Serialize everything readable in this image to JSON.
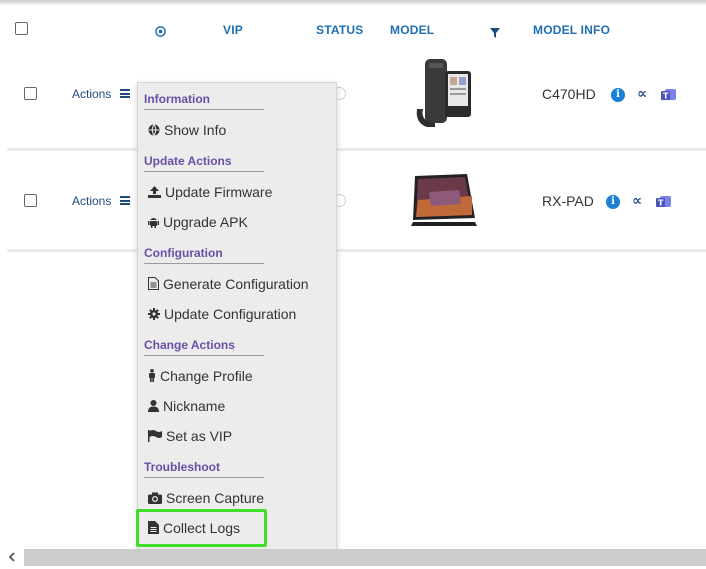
{
  "header": {
    "vip": "VIP",
    "status": "STATUS",
    "model": "MODEL",
    "model_info": "MODEL INFO",
    "target_icon": "target-icon",
    "filter_icon": "filter-icon"
  },
  "rows": [
    {
      "actions_label": "Actions",
      "model_name": "C470HD"
    },
    {
      "actions_label": "Actions",
      "model_name": "RX-PAD"
    }
  ],
  "menu": {
    "sections": [
      {
        "title": "Information",
        "items": [
          "Show Info"
        ]
      },
      {
        "title": "Update Actions",
        "items": [
          "Update Firmware",
          "Upgrade APK"
        ]
      },
      {
        "title": "Configuration",
        "items": [
          "Generate Configuration",
          "Update Configuration"
        ]
      },
      {
        "title": "Change Actions",
        "items": [
          "Change Profile",
          "Nickname",
          "Set as VIP"
        ]
      },
      {
        "title": "Troubleshoot",
        "items": [
          "Screen Capture",
          "Collect Logs"
        ]
      }
    ]
  },
  "colors": {
    "header_blue": "#1f6fb2",
    "section_purple": "#6a4fa7",
    "highlight_green": "#3ee02c",
    "menu_bg": "#ececec"
  }
}
